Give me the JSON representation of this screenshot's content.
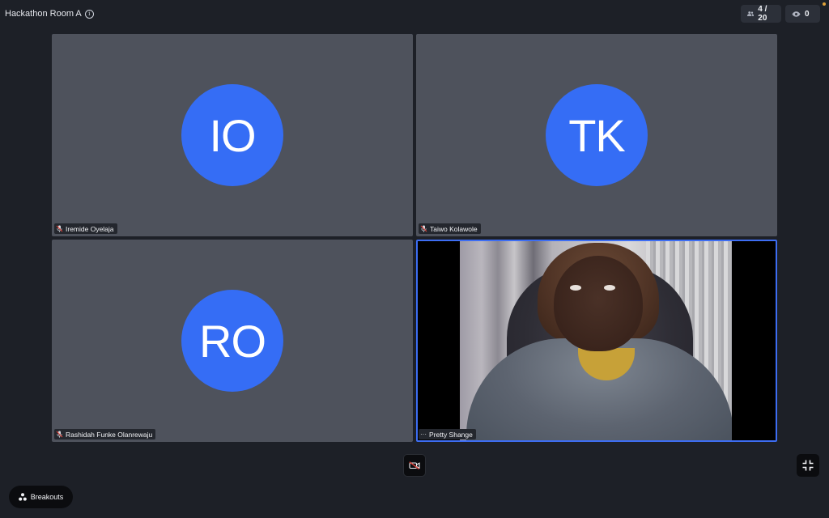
{
  "header": {
    "room_title": "Hackathon Room A",
    "info_icon": "info-icon",
    "participants_count": "4 / 20",
    "viewers_count": "0",
    "participants_icon": "people-icon",
    "viewers_icon": "eye-icon"
  },
  "tiles": [
    {
      "initials": "IO",
      "name": "Iremide Oyelaja",
      "mic": "muted"
    },
    {
      "initials": "TK",
      "name": "Taiwo Kolawole",
      "mic": "muted"
    },
    {
      "initials": "RO",
      "name": "Rashidah Funke Olanrewaju",
      "mic": "muted"
    },
    {
      "initials": "",
      "name": "Pretty Shange",
      "menu_icon": "more-dots-icon",
      "video": "on",
      "active_speaker": true
    }
  ],
  "controls": {
    "camera_icon": "camera-off-icon",
    "minimize_icon": "minimize-icon",
    "breakouts_label": "Breakouts",
    "breakouts_icon": "breakouts-icon"
  },
  "colors": {
    "avatar": "#356df5",
    "active_border": "#3d6df2",
    "tile_background": "#4e525c",
    "app_background": "#1d2027"
  }
}
